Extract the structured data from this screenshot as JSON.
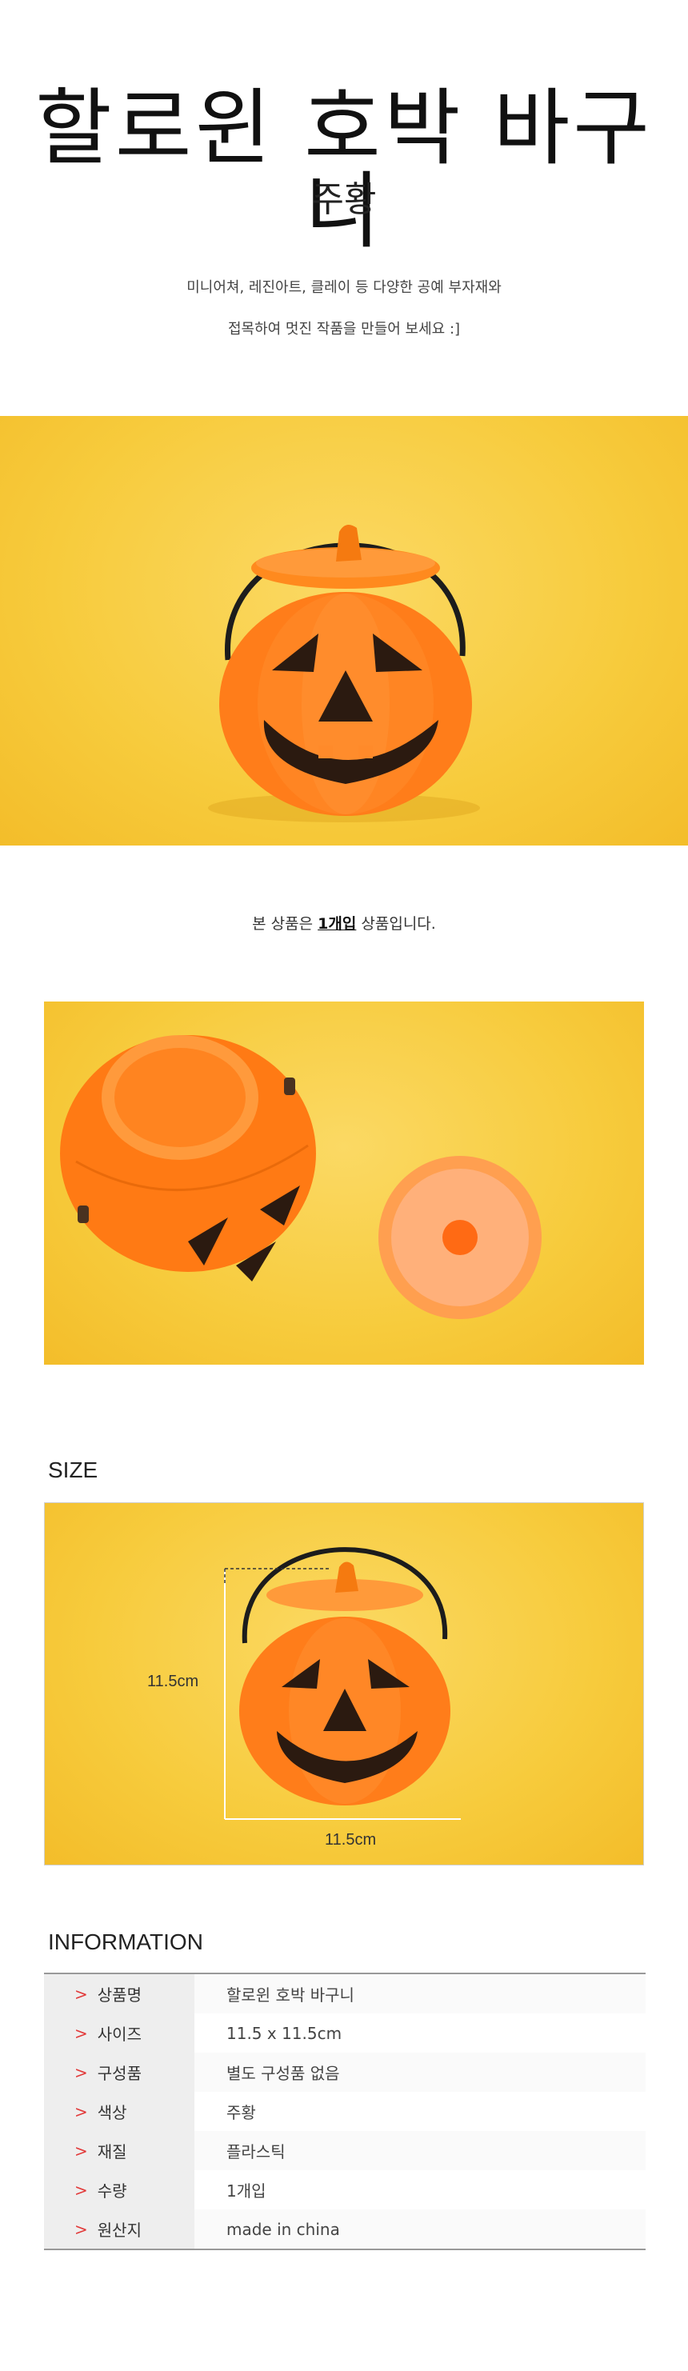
{
  "header": {
    "title": "할로윈 호박 바구니",
    "subtitle": "주황",
    "desc_line1": "미니어쳐, 레진아트, 클레이 등 다양한 공예 부자재와",
    "desc_line2": "접목하여 멋진 작품을 만들어 보세요 :]"
  },
  "note": {
    "prefix": "본 상품은 ",
    "highlight": "1개입",
    "suffix": " 상품입니다."
  },
  "size_section": {
    "heading": "SIZE",
    "height_label": "11.5cm",
    "width_label": "11.5cm"
  },
  "info_section": {
    "heading": "INFORMATION",
    "arrow": ">",
    "rows": [
      {
        "key": "상품명",
        "value": "할로윈 호박 바구니"
      },
      {
        "key": "사이즈",
        "value": "11.5 x 11.5cm"
      },
      {
        "key": "구성품",
        "value": "별도 구성품 없음"
      },
      {
        "key": "색상",
        "value": "주황"
      },
      {
        "key": "재질",
        "value": "플라스틱"
      },
      {
        "key": "수량",
        "value": "1개입"
      },
      {
        "key": "원산지",
        "value": "made in china"
      }
    ]
  },
  "colors": {
    "background_yellow": "#f7cb3c",
    "pumpkin_orange": "#ff7a1a",
    "arrow_red": "#e23a3a"
  }
}
